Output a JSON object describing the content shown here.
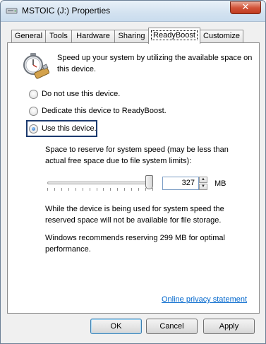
{
  "window": {
    "title": "MSTOIC (J:) Properties",
    "close_glyph": "✕",
    "accent_color": "#d2543a"
  },
  "tabs": [
    {
      "label": "General"
    },
    {
      "label": "Tools"
    },
    {
      "label": "Hardware"
    },
    {
      "label": "Sharing"
    },
    {
      "label": "ReadyBoost",
      "active": true
    },
    {
      "label": "Customize"
    }
  ],
  "readyboost": {
    "icon": "stopwatch-usb-icon",
    "intro": "Speed up your system by utilizing the available space on this device.",
    "options": [
      {
        "label": "Do not use this device.",
        "checked": false
      },
      {
        "label": "Dedicate this device to ReadyBoost.",
        "checked": false
      },
      {
        "label": "Use this device.",
        "checked": true
      }
    ],
    "reserve_label": "Space to reserve for system speed (may be less than actual free space due to file system limits):",
    "reserve_value": "327",
    "reserve_unit": "MB",
    "slider_fraction": 0.96,
    "usage_note": "While the device is being used for system speed the reserved space will not be available for file storage.",
    "recommendation": "Windows recommends reserving 299 MB for optimal performance.",
    "privacy_link": "Online privacy statement"
  },
  "buttons": {
    "ok": "OK",
    "cancel": "Cancel",
    "apply": "Apply"
  }
}
